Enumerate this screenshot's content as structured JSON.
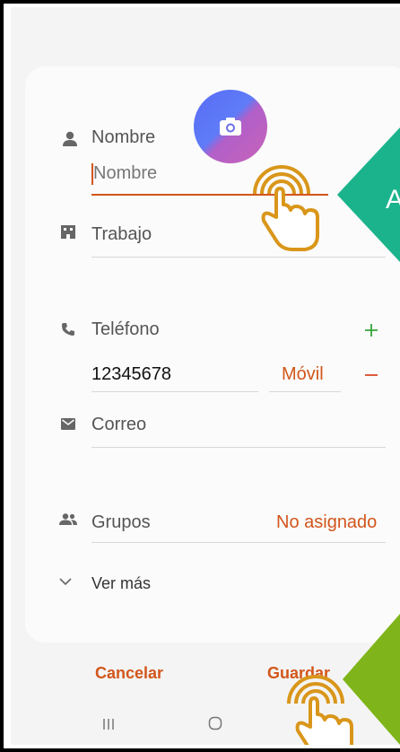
{
  "form": {
    "name_label": "Nombre",
    "name_placeholder": "Nombre",
    "work_label": "Trabajo",
    "phone_label": "Teléfono",
    "phone_value": "12345678",
    "phone_type": "Móvil",
    "email_label": "Correo",
    "groups_label": "Grupos",
    "groups_value": "No asignado",
    "more_label": "Ver más"
  },
  "actions": {
    "cancel": "Cancelar",
    "save": "Guardar"
  },
  "overlay": {
    "callout_text": "A"
  },
  "colors": {
    "accent_orange": "#d2561b",
    "add_green": "#37a43a",
    "callout_teal": "#1bb38c",
    "callout_lime": "#7fb51a",
    "hand_gold": "#d9961a"
  },
  "icons": [
    "camera-icon",
    "person-icon",
    "building-icon",
    "phone-icon",
    "email-icon",
    "group-icon",
    "chevron-down-icon",
    "recent-apps-icon",
    "home-icon",
    "back-icon",
    "tap-hand-icon"
  ]
}
